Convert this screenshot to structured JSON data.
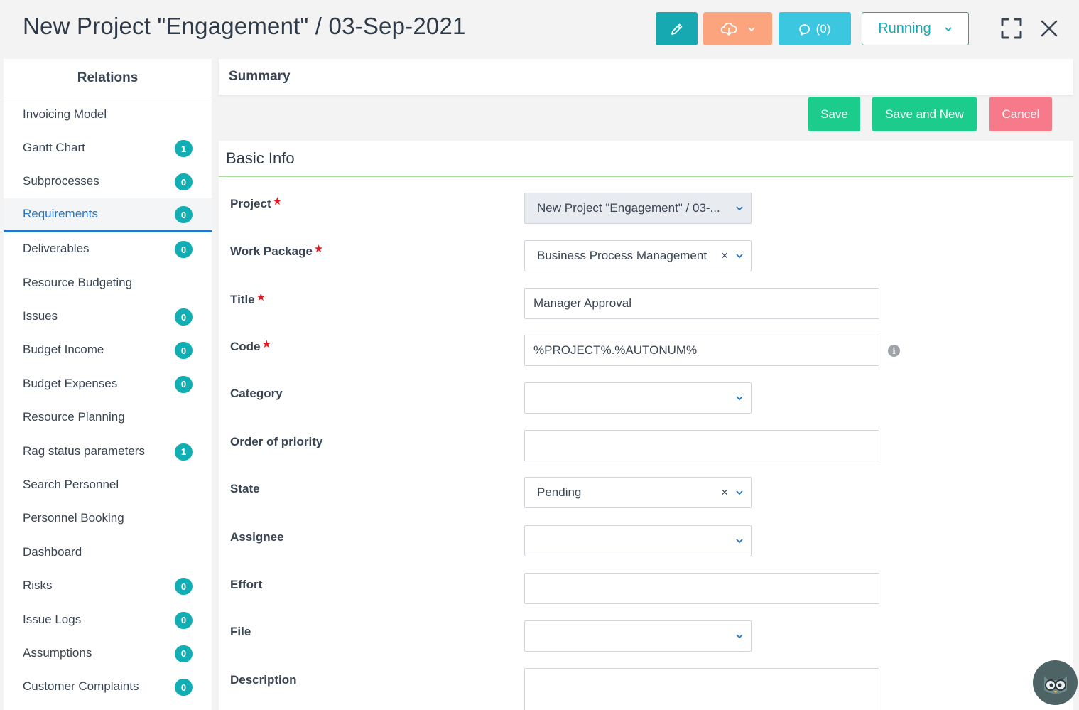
{
  "header": {
    "title": "New Project \"Engagement\" / 03-Sep-2021",
    "comments_label": "(0)",
    "status_label": "Running"
  },
  "colors": {
    "teal": "#17a9b1",
    "orange": "#fba47e",
    "cyan": "#3bc7e0",
    "green": "#1bcc8d",
    "pink": "#f77a8a",
    "active_blue": "#2476c6",
    "badge": "#11aeb3",
    "required": "#e5141f"
  },
  "icons": {
    "edit": "pencil-icon",
    "cloud": "cloud-download-icon",
    "comment": "comment-icon",
    "expand": "fullscreen-icon",
    "close": "close-icon",
    "info": "info-icon",
    "assistant": "owl-assistant-icon"
  },
  "sidebar": {
    "heading": "Relations",
    "items": [
      {
        "label": "Invoicing Model",
        "badge": null
      },
      {
        "label": "Gantt Chart",
        "badge": "1"
      },
      {
        "label": "Subprocesses",
        "badge": "0"
      },
      {
        "label": "Requirements",
        "badge": "0",
        "active": true
      },
      {
        "label": "Deliverables",
        "badge": "0"
      },
      {
        "label": "Resource Budgeting",
        "badge": null
      },
      {
        "label": "Issues",
        "badge": "0"
      },
      {
        "label": "Budget Income",
        "badge": "0"
      },
      {
        "label": "Budget Expenses",
        "badge": "0"
      },
      {
        "label": "Resource Planning",
        "badge": null
      },
      {
        "label": "Rag status parameters",
        "badge": "1"
      },
      {
        "label": "Search Personnel",
        "badge": null
      },
      {
        "label": "Personnel Booking",
        "badge": null
      },
      {
        "label": "Dashboard",
        "badge": null
      },
      {
        "label": "Risks",
        "badge": "0"
      },
      {
        "label": "Issue Logs",
        "badge": "0"
      },
      {
        "label": "Assumptions",
        "badge": "0"
      },
      {
        "label": "Customer Complaints",
        "badge": "0"
      }
    ]
  },
  "summary": {
    "label": "Summary"
  },
  "actions": {
    "save": "Save",
    "save_and_new": "Save and New",
    "cancel": "Cancel"
  },
  "form": {
    "section_title": "Basic Info",
    "required_mark": "★",
    "clear_mark": "×",
    "info_mark": "i",
    "fields": {
      "project": {
        "label": "Project",
        "value": "New Project \"Engagement\" / 03-..."
      },
      "work_package": {
        "label": "Work Package",
        "value": "Business Process Management"
      },
      "title": {
        "label": "Title",
        "value": "Manager Approval"
      },
      "code": {
        "label": "Code",
        "value": "%PROJECT%.%AUTONUM%"
      },
      "category": {
        "label": "Category",
        "value": ""
      },
      "priority": {
        "label": "Order of priority",
        "value": ""
      },
      "state": {
        "label": "State",
        "value": "Pending"
      },
      "assignee": {
        "label": "Assignee",
        "value": ""
      },
      "effort": {
        "label": "Effort",
        "value": ""
      },
      "file": {
        "label": "File",
        "value": ""
      },
      "description": {
        "label": "Description",
        "value": ""
      }
    }
  }
}
